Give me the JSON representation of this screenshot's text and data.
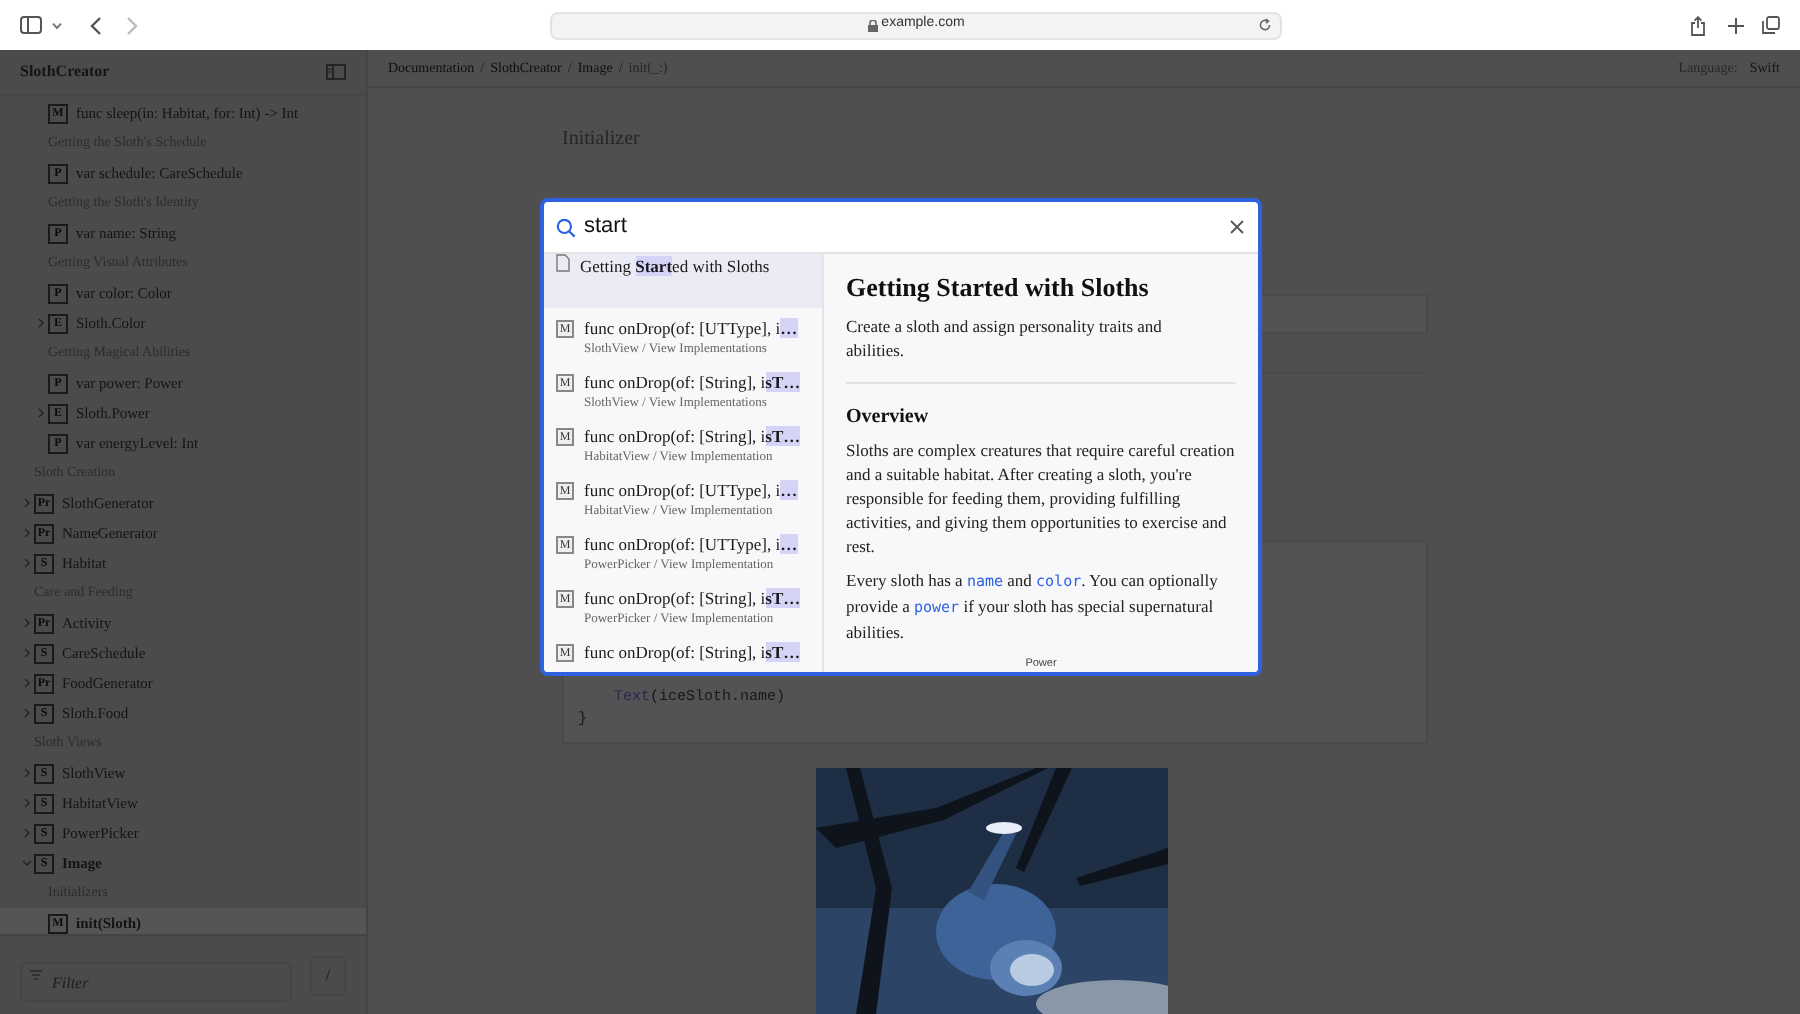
{
  "browser": {
    "url": "example.com"
  },
  "sidebar": {
    "title": "SlothCreator",
    "scrolled_children": [
      {
        "kind": "symbol",
        "badge": "M",
        "label": "func sleep(in: Habitat, for: Int) -> Int",
        "selected": false
      },
      {
        "kind": "heading",
        "label": "Getting the Sloth's Schedule"
      },
      {
        "kind": "symbol",
        "badge": "P",
        "label": "var schedule: CareSchedule",
        "selected": false
      },
      {
        "kind": "heading",
        "label": "Getting the Sloth's Identity"
      },
      {
        "kind": "symbol",
        "badge": "P",
        "label": "var name: String",
        "selected": false
      },
      {
        "kind": "heading",
        "label": "Getting Visual Attributes"
      },
      {
        "kind": "symbol",
        "badge": "P",
        "label": "var color: Color",
        "selected": false
      },
      {
        "kind": "symbol",
        "badge": "E",
        "label": "Sloth.Color",
        "selected": false,
        "expanded": false
      },
      {
        "kind": "heading",
        "label": "Getting Magical Abilities"
      },
      {
        "kind": "symbol",
        "badge": "P",
        "label": "var power: Power",
        "selected": false
      },
      {
        "kind": "symbol",
        "badge": "E",
        "label": "Sloth.Power",
        "selected": false,
        "expanded": false
      },
      {
        "kind": "symbol",
        "badge": "P",
        "label": "var energyLevel: Int",
        "selected": false
      }
    ],
    "items": [
      {
        "kind": "heading",
        "label": "Sloth Creation"
      },
      {
        "kind": "symbol",
        "badge": "Pr",
        "label": "SlothGenerator",
        "selected": false,
        "expanded": false
      },
      {
        "kind": "symbol",
        "badge": "Pr",
        "label": "NameGenerator",
        "selected": false,
        "expanded": false
      },
      {
        "kind": "symbol",
        "badge": "S",
        "label": "Habitat",
        "selected": false,
        "expanded": false
      },
      {
        "kind": "heading",
        "label": "Care and Feeding"
      },
      {
        "kind": "symbol",
        "badge": "Pr",
        "label": "Activity",
        "selected": false,
        "expanded": false
      },
      {
        "kind": "symbol",
        "badge": "S",
        "label": "CareSchedule",
        "selected": false,
        "expanded": false
      },
      {
        "kind": "symbol",
        "badge": "Pr",
        "label": "FoodGenerator",
        "selected": false,
        "expanded": false
      },
      {
        "kind": "symbol",
        "badge": "S",
        "label": "Sloth.Food",
        "selected": false,
        "expanded": false
      },
      {
        "kind": "heading",
        "label": "Sloth Views"
      },
      {
        "kind": "symbol",
        "badge": "S",
        "label": "SlothView",
        "selected": false,
        "expanded": false
      },
      {
        "kind": "symbol",
        "badge": "S",
        "label": "HabitatView",
        "selected": false,
        "expanded": false
      },
      {
        "kind": "symbol",
        "badge": "S",
        "label": "PowerPicker",
        "selected": false,
        "expanded": false
      },
      {
        "kind": "symbol",
        "badge": "S",
        "label": "Image",
        "selected": false,
        "expanded": true,
        "children": [
          {
            "kind": "heading",
            "label": "Initializers"
          },
          {
            "kind": "symbol",
            "badge": "M",
            "label": "init(Sloth)",
            "selected": true
          }
        ]
      }
    ],
    "filter": {
      "placeholder": "Filter"
    },
    "shortcut": "/"
  },
  "header": {
    "breadcrumbs": [
      {
        "label": "Documentation",
        "current": false
      },
      {
        "label": "SlothCreator",
        "current": false
      },
      {
        "label": "Image",
        "current": false
      },
      {
        "label": "init(_:)",
        "current": true
      }
    ],
    "separator": "/",
    "language_label": "Language:",
    "language": "Swift"
  },
  "page": {
    "eyebrow": "Initializer",
    "code_lines": [
      {
        "kind": "call",
        "name": "Text",
        "rest": "(iceSloth.name)"
      },
      {
        "kind": "plain",
        "text": "}"
      }
    ]
  },
  "search": {
    "value": "start",
    "results": [
      {
        "kind": "article",
        "title": "Getting **Start**ed with Sloths",
        "selected": true
      },
      {
        "kind": "method",
        "badge": "M",
        "title": "func onDrop(of: [UTType], i**…**",
        "path": "SlothView / View Implementations",
        "selected": false
      },
      {
        "kind": "method",
        "badge": "M",
        "title": "func onDrop(of: [String], i**sT…**",
        "path": "SlothView / View Implementations",
        "selected": false
      },
      {
        "kind": "method",
        "badge": "M",
        "title": "func onDrop(of: [String], i**sT…**",
        "path": "HabitatView / View Implementation",
        "selected": false
      },
      {
        "kind": "method",
        "badge": "M",
        "title": "func onDrop(of: [UTType], i**…**",
        "path": "HabitatView / View Implementation",
        "selected": false
      },
      {
        "kind": "method",
        "badge": "M",
        "title": "func onDrop(of: [UTType], i**…**",
        "path": "PowerPicker / View Implementation",
        "selected": false
      },
      {
        "kind": "method",
        "badge": "M",
        "title": "func onDrop(of: [String], i**sT…**",
        "path": "PowerPicker / View Implementation",
        "selected": false
      },
      {
        "kind": "method",
        "badge": "M",
        "title": "func onDrop(of: [String], i**sT…**",
        "selected": false
      }
    ],
    "preview": {
      "title": "Getting Started with Sloths",
      "abstract": "Create a sloth and assign personality traits and abilities.",
      "section": "Overview",
      "paragraphs": [
        [
          {
            "kind": "text",
            "text": "Sloths are complex creatures that require careful creation and a suitable habitat. After creating a sloth, you're responsible for feeding them, providing fulfilling activities, and giving them opportunities to exercise and rest."
          }
        ],
        [
          {
            "kind": "text",
            "text": "Every sloth has a "
          },
          {
            "kind": "code",
            "text": "name"
          },
          {
            "kind": "text",
            "text": " and "
          },
          {
            "kind": "code",
            "text": "color"
          },
          {
            "kind": "text",
            "text": ". You can optionally provide a "
          },
          {
            "kind": "code",
            "text": "power"
          },
          {
            "kind": "text",
            "text": " if your sloth has special supernatural abilities."
          }
        ]
      ],
      "caption": "Power"
    }
  }
}
